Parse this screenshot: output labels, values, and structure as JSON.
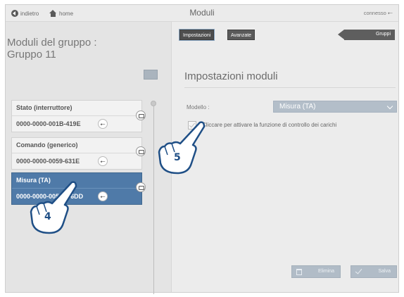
{
  "topbar": {
    "back_label": "indietro",
    "home_label": "home",
    "title": "Moduli",
    "status": "connesso"
  },
  "left": {
    "heading_line1": "Moduli del gruppo :",
    "heading_line2": "Gruppo 11",
    "modules": [
      {
        "name": "Stato (interruttore)",
        "id": "0000-0000-001B-419E",
        "selected": false
      },
      {
        "name": "Comando (generico)",
        "id": "0000-0000-0059-631E",
        "selected": false
      },
      {
        "name": "Misura (TA)",
        "id": "0000-0000-005",
        "id_tail": "6DD",
        "selected": true
      }
    ]
  },
  "right": {
    "tabs": [
      "Impostazioni",
      "Avanzate"
    ],
    "groups_button": "Gruppi",
    "section_title": "Impostazioni moduli",
    "model_label": "Modello :",
    "model_value": "Misura (TA)",
    "checkbox_label": "Cliccare per attivare la funzione di controllo dei carichi",
    "delete_label": "Elimina",
    "save_label": "Salva"
  },
  "callouts": [
    "4",
    "5"
  ],
  "colors": {
    "selected_card": "#4f7aa8",
    "select_bg": "#b3bec9",
    "callout_text": "#1f4f86"
  }
}
